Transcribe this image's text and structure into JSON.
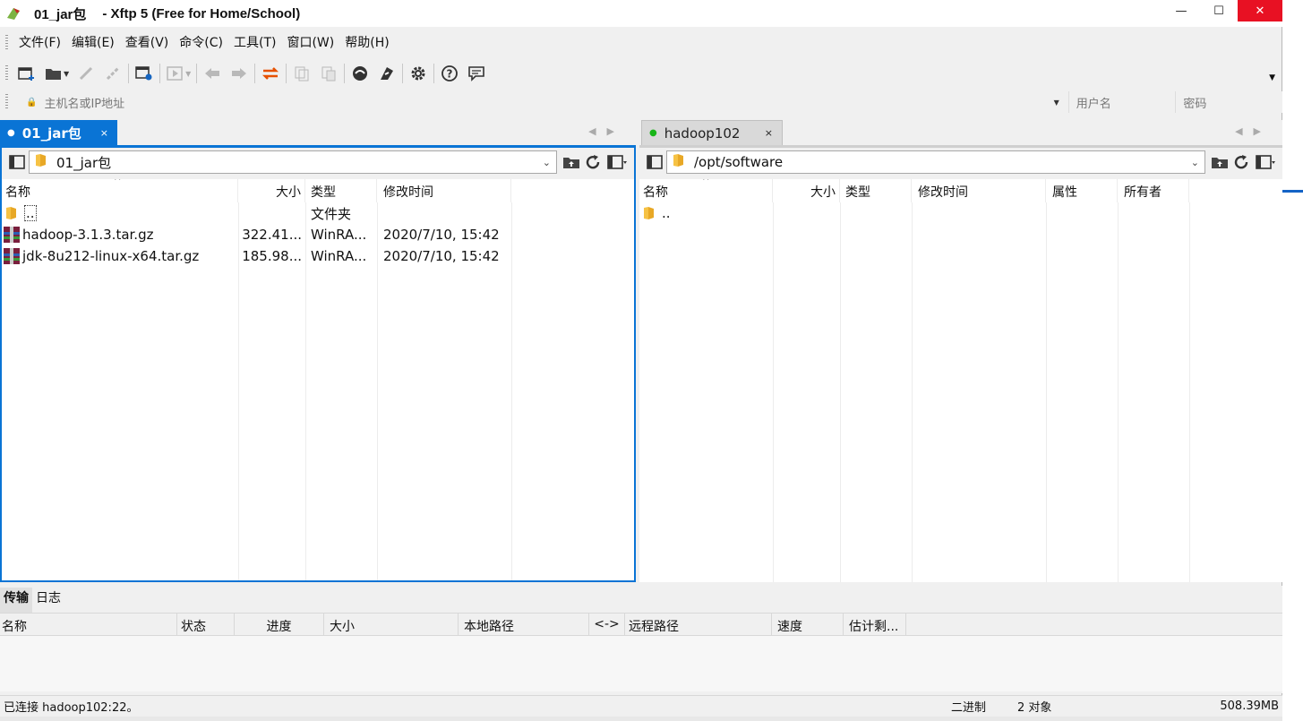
{
  "window": {
    "folder_title": "01_jar包",
    "app_title": "- Xftp 5 (Free for Home/School)"
  },
  "menu": [
    "文件(F)",
    "编辑(E)",
    "查看(V)",
    "命令(C)",
    "工具(T)",
    "窗口(W)",
    "帮助(H)"
  ],
  "toolbar": {
    "icons": [
      "new-session-icon",
      "open-folder-icon",
      "connect-icon",
      "disconnect-icon",
      "properties-icon",
      "play-icon",
      "back-icon",
      "forward-icon",
      "sync-icon",
      "copy-icon",
      "paste-icon",
      "xshell-icon",
      "xftp-icon",
      "settings-icon",
      "help-icon",
      "feedback-icon"
    ]
  },
  "address": {
    "host_placeholder": "主机名或IP地址",
    "user_placeholder": "用户名",
    "pass_placeholder": "密码"
  },
  "left_pane": {
    "tab_label": "01_jar包",
    "path": "01_jar包",
    "columns": [
      "名称",
      "大小",
      "类型",
      "修改时间"
    ],
    "rows": [
      {
        "name": "..",
        "size": "",
        "type": "文件夹",
        "modified": "",
        "icon": "folder-icon"
      },
      {
        "name": "hadoop-3.1.3.tar.gz",
        "size": "322.41...",
        "type": "WinRA...",
        "modified": "2020/7/10, 15:42",
        "icon": "archive-icon"
      },
      {
        "name": "jdk-8u212-linux-x64.tar.gz",
        "size": "185.98...",
        "type": "WinRA...",
        "modified": "2020/7/10, 15:42",
        "icon": "archive-icon"
      }
    ]
  },
  "right_pane": {
    "tab_label": "hadoop102",
    "path": "/opt/software",
    "columns": [
      "名称",
      "大小",
      "类型",
      "修改时间",
      "属性",
      "所有者"
    ],
    "rows": [
      {
        "name": "..",
        "icon": "folder-icon"
      }
    ]
  },
  "transfer": {
    "tabs": [
      "传输",
      "日志"
    ],
    "columns": [
      "名称",
      "状态",
      "进度",
      "大小",
      "本地路径",
      "<->",
      "远程路径",
      "速度",
      "估计剩..."
    ]
  },
  "status": {
    "connection": "已连接 hadoop102:22。",
    "mode": "二进制",
    "count": "2 对象",
    "size": "508.39MB"
  },
  "colors": {
    "accent": "#0a74d5",
    "connected_dot": "#18b518",
    "close_button": "#e81123"
  }
}
